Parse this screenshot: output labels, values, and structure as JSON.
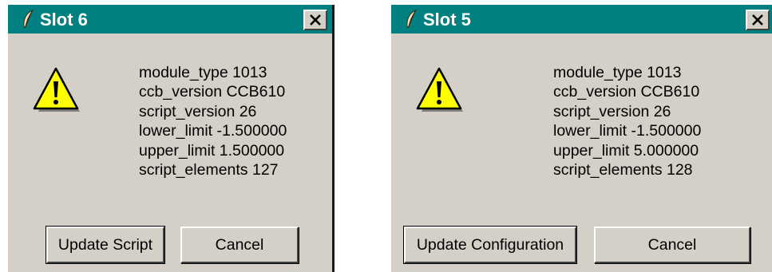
{
  "colors": {
    "titlebar": "#008080",
    "dialog_face": "#d4d0c8",
    "warning_yellow": "#ffff00"
  },
  "dialogs": [
    {
      "title": "Slot 6",
      "title_icon": "feather-icon",
      "close_icon": "close-icon",
      "message_icon": "warning-icon",
      "lines": [
        "module_type 1013",
        "ccb_version CCB610",
        "script_version 26",
        "lower_limit -1.500000",
        "upper_limit 1.500000",
        "script_elements 127"
      ],
      "buttons": [
        "Update Script",
        "Cancel"
      ]
    },
    {
      "title": "Slot 5",
      "title_icon": "feather-icon",
      "close_icon": "close-icon",
      "message_icon": "warning-icon",
      "lines": [
        "module_type 1013",
        "ccb_version CCB610",
        "script_version 26",
        "lower_limit -1.500000",
        "upper_limit 5.000000",
        "script_elements 128"
      ],
      "buttons": [
        "Update Configuration",
        "Cancel"
      ]
    }
  ]
}
